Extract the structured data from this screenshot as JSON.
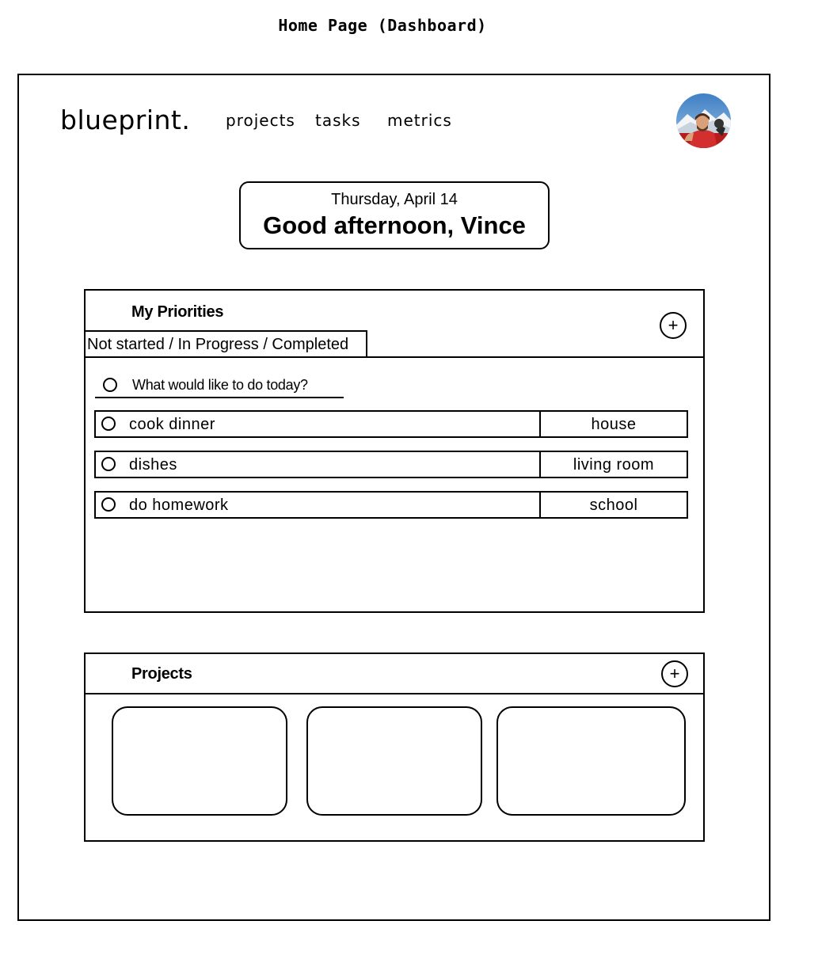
{
  "page_title": "Home Page (Dashboard)",
  "header": {
    "logo": "blueprint.",
    "nav": {
      "projects": "projects",
      "tasks": "tasks",
      "metrics": "metrics"
    }
  },
  "greeting": {
    "date": "Thursday, April 14",
    "message": "Good afternoon, Vince"
  },
  "priorities": {
    "title": "My Priorities",
    "add_label": "+",
    "filter_label": "Not started / In Progress / Completed",
    "new_task_placeholder": "What would like to do today?",
    "tasks": [
      {
        "name": "cook dinner",
        "tag": "house"
      },
      {
        "name": "dishes",
        "tag": "living room"
      },
      {
        "name": "do homework",
        "tag": "school"
      }
    ]
  },
  "projects": {
    "title": "Projects",
    "add_label": "+"
  }
}
